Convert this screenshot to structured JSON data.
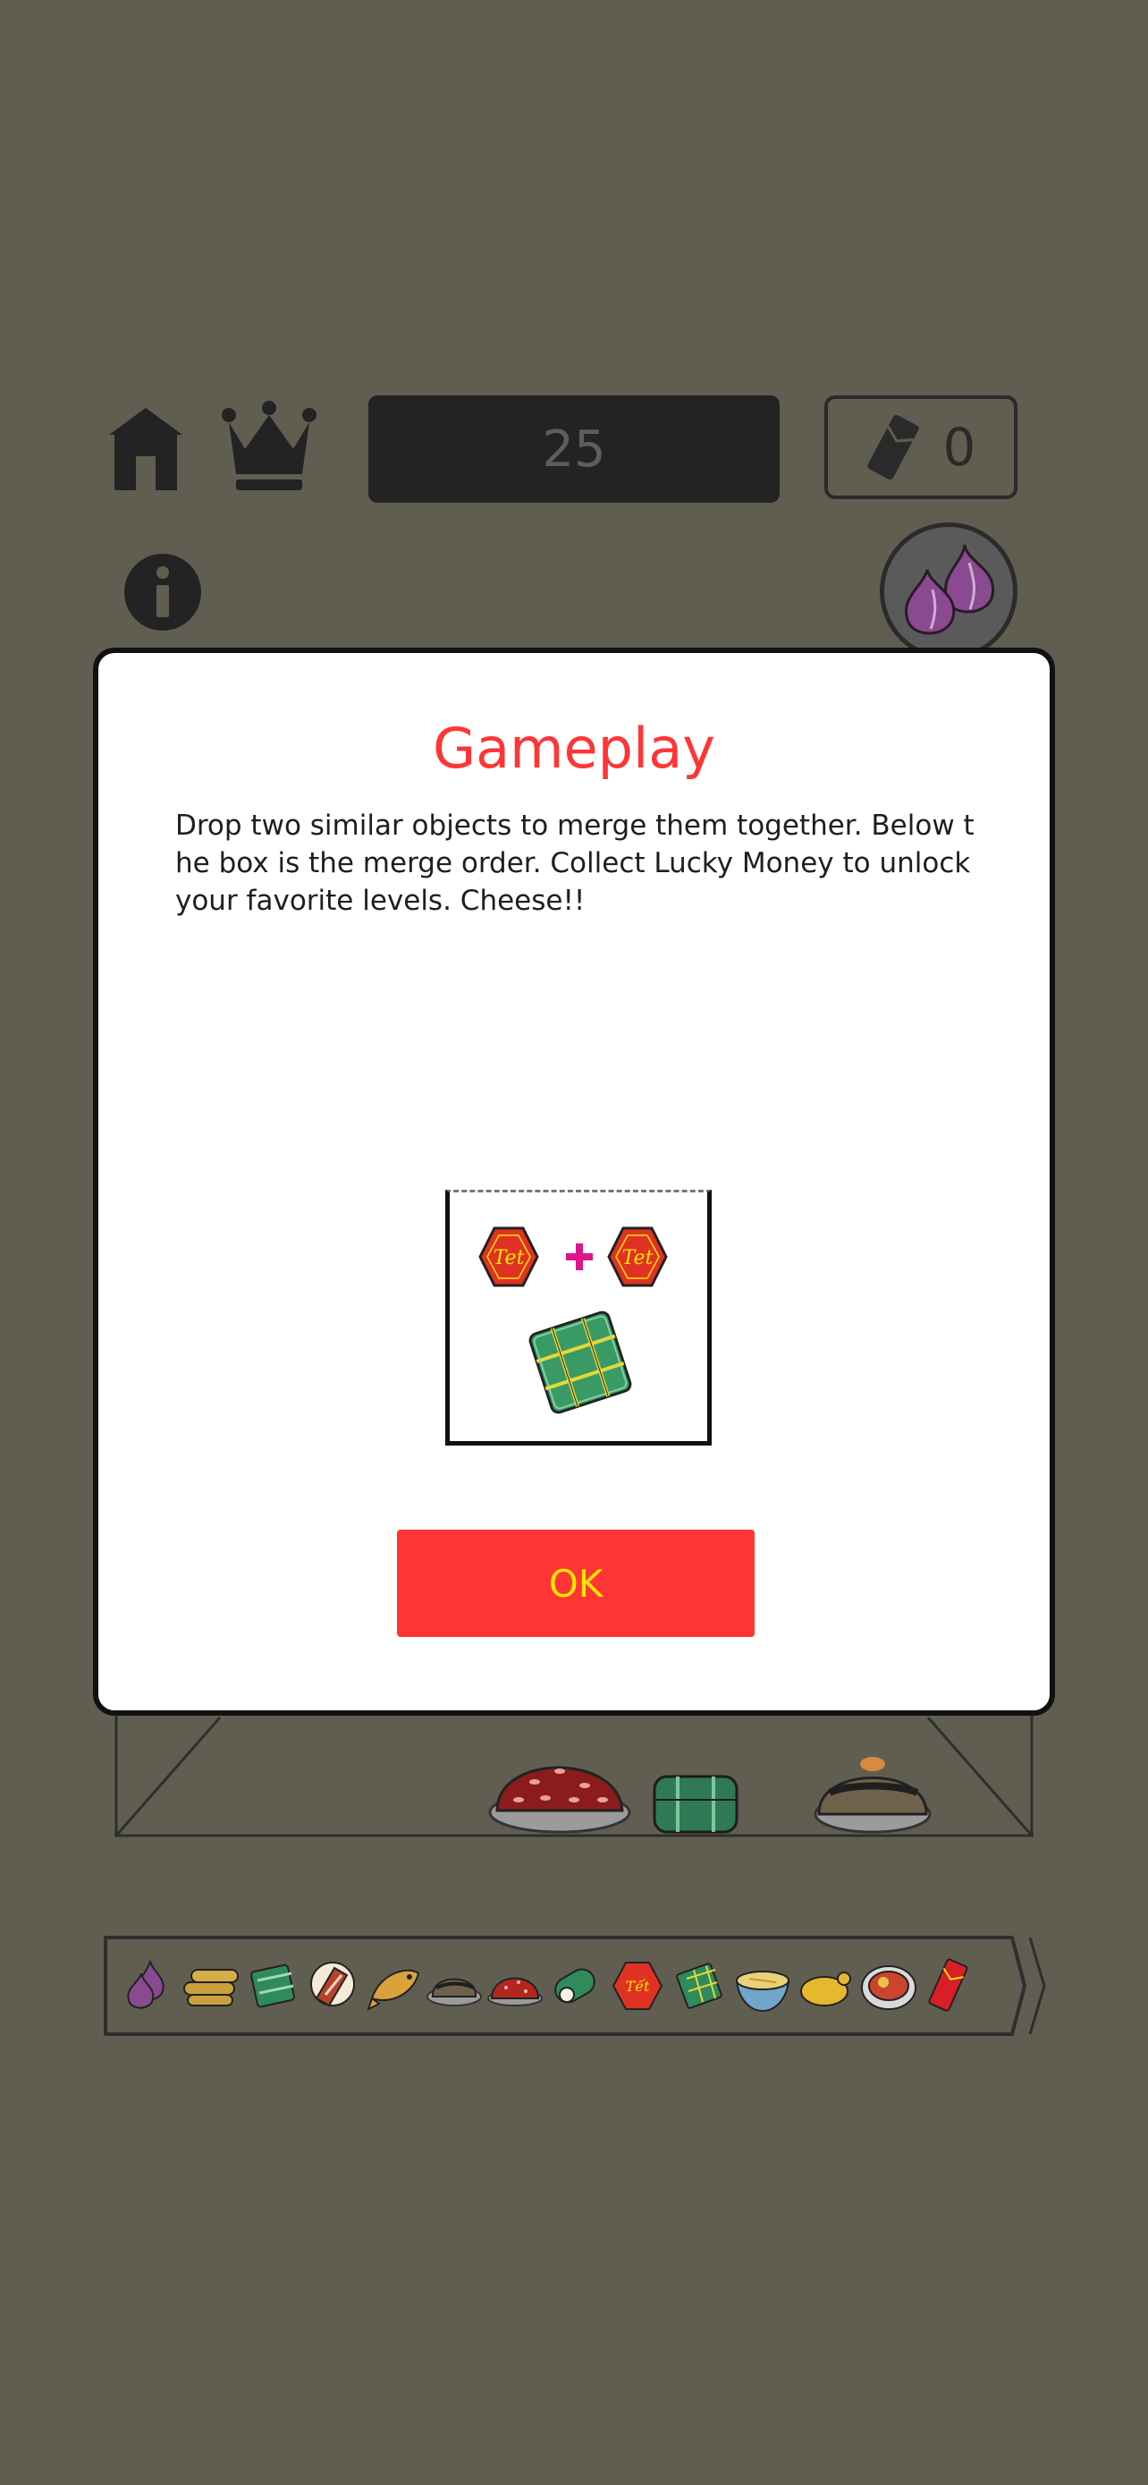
{
  "header": {
    "score": "25",
    "money": "0"
  },
  "modal": {
    "title": "Gameplay",
    "text": "Drop two similar objects to merge them together. Below the box is the merge order. Collect Lucky Money to unlock your favorite levels. Cheese!!",
    "ok_label": "OK",
    "demo_token_label": "Tet"
  },
  "merge_order": [
    "onion",
    "spring-rolls",
    "banh-chung",
    "cured-pork",
    "fish",
    "sticky-rice-cake",
    "red-sticky-rice",
    "banh-tet",
    "tet-coin",
    "banh-chung-box",
    "pho-bowl",
    "boiled-chicken",
    "hot-pot",
    "lucky-money"
  ],
  "colors": {
    "background": "#605e51",
    "accent_red": "#ff3535",
    "ok_text": "#ffe600",
    "score_box": "#232323"
  }
}
